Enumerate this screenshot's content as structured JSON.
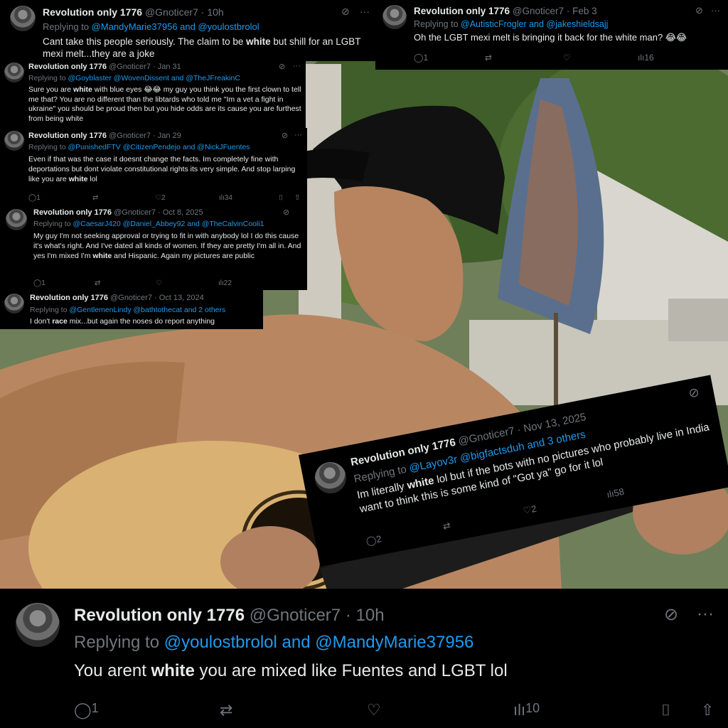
{
  "user": {
    "name": "Revolution only 1776",
    "handle": "@Gnoticer7"
  },
  "tweets": [
    {
      "time": "10h",
      "reply_prefix": "Replying to",
      "reply_to": "@MandyMarie37956 and @youlostbrolol",
      "text_before": "Cant take this people seriously. The claim to be ",
      "highlight": "white",
      "text_after": " but shill for an LGBT mexi melt...they are a joke"
    },
    {
      "time": "Feb 3",
      "reply_prefix": "Replying to",
      "reply_to": "@AutisticFrogler and @jakeshieldsajj",
      "text_before": "Oh the LGBT mexi melt is bringing it back for the white man? 😂😂",
      "highlight": "",
      "text_after": "",
      "replies": "1",
      "views": "16"
    },
    {
      "time": "Jan 31",
      "reply_prefix": "Replying to",
      "reply_to": "@Goyblaster @WovenDissent and @TheJFreakinC",
      "text_before": "Sure you are ",
      "highlight": "white",
      "text_after": " with blue eyes 😂😂 my guy you think you the first clown to tell me that? You are no different than the libtards who told me \"Im a vet a fight in ukraine\" you should be proud then but you hide odds are its cause you are furthest from being white"
    },
    {
      "time": "Jan 29",
      "reply_prefix": "Replying to",
      "reply_to": "@PunishedFTV @CitizenPendejo and @NickJFuentes",
      "text_before": "Even if that was the case it doesnt change the facts. Im completely fine with deportations but dont violate constitutional rights its very simple. And stop larping like you are ",
      "highlight": "white",
      "text_after": " lol",
      "replies": "1",
      "likes": "2",
      "views": "34"
    },
    {
      "time": "Oct 8, 2025",
      "reply_prefix": "Replying to",
      "reply_to": "@CaesarJ420 @Daniel_Abbey92 and @TheCalvinCooli1",
      "text_before": "My guy I'm not seeking approval or trying to fit in with anybody lol I do this cause it's what's right. And I've dated all kinds of women. If they are pretty I'm all in. And yes I'm mixed I'm ",
      "highlight": "white",
      "text_after": " and Hispanic. Again my pictures are public",
      "replies": "1",
      "views": "22"
    },
    {
      "time": "Oct 13, 2024",
      "reply_prefix": "Replying to",
      "reply_to": "@GentlemenLindy @bathtothecat and 2 others",
      "text_before": "I don't ",
      "highlight": "race",
      "text_after": " mix...but again the noses do report anything"
    },
    {
      "time": "Nov 13, 2025",
      "reply_prefix": "Replying to",
      "reply_to": "@Layov3r @bigfactsduh and 3 others",
      "text_before": "Im literally ",
      "highlight": "white",
      "text_after": " lol but if the bots with no pictures who probably live in India want to think this is some kind of \"Got ya\" go for it lol",
      "replies": "2",
      "likes": "2",
      "views": "58"
    },
    {
      "time": "10h",
      "reply_prefix": "Replying to",
      "reply_to": "@youlostbrolol and @MandyMarie37956",
      "text_before": "You arent ",
      "highlight": "white",
      "text_after": " you are mixed like Fuentes and LGBT lol",
      "replies": "1",
      "views": "10"
    }
  ],
  "icons": {
    "reply": "speech-bubble",
    "retweet": "⇄",
    "like": "♡",
    "views": "bar-chart",
    "bookmark": "bookmark",
    "share": "share",
    "grok": "grok-slash",
    "more": "···"
  },
  "colors": {
    "link": "#1d9bf0",
    "muted": "#71767b",
    "text": "#e7e9ea",
    "card": "#000000"
  }
}
